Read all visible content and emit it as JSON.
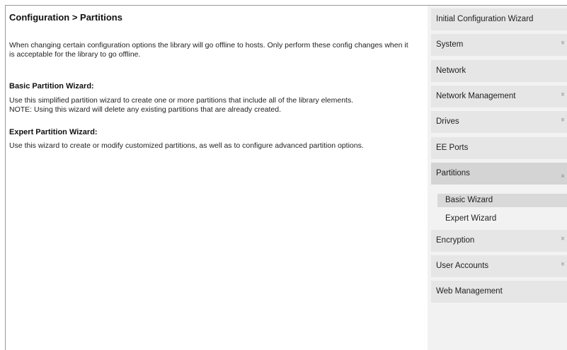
{
  "main": {
    "title": "Configuration > Partitions",
    "intro": "When changing certain configuration options the library will go offline to hosts. Only perform these config changes when it is acceptable for the library to go offline.",
    "sections": [
      {
        "title": "Basic Partition Wizard:",
        "lines": [
          "Use this simplified partition wizard to create one or more partitions that include all of the library elements.",
          "NOTE: Using this wizard will delete any existing partitions that are already created."
        ]
      },
      {
        "title": "Expert Partition Wizard:",
        "lines": [
          "Use this wizard to create or modify customized partitions, as well as to configure advanced partition options."
        ]
      }
    ]
  },
  "sidebar": {
    "items": [
      {
        "label": "Initial Configuration Wizard",
        "chevron": ""
      },
      {
        "label": "System",
        "chevron": "»"
      },
      {
        "label": "Network",
        "chevron": ""
      },
      {
        "label": "Network Management",
        "chevron": "»"
      },
      {
        "label": "Drives",
        "chevron": "»"
      },
      {
        "label": "EE Ports",
        "chevron": ""
      },
      {
        "label": "Partitions",
        "chevron": "»"
      },
      {
        "label": "Encryption",
        "chevron": "»"
      },
      {
        "label": "User Accounts",
        "chevron": "»"
      },
      {
        "label": "Web Management",
        "chevron": ""
      }
    ],
    "sub_items": [
      {
        "label": "Basic Wizard"
      },
      {
        "label": "Expert Wizard"
      }
    ]
  }
}
